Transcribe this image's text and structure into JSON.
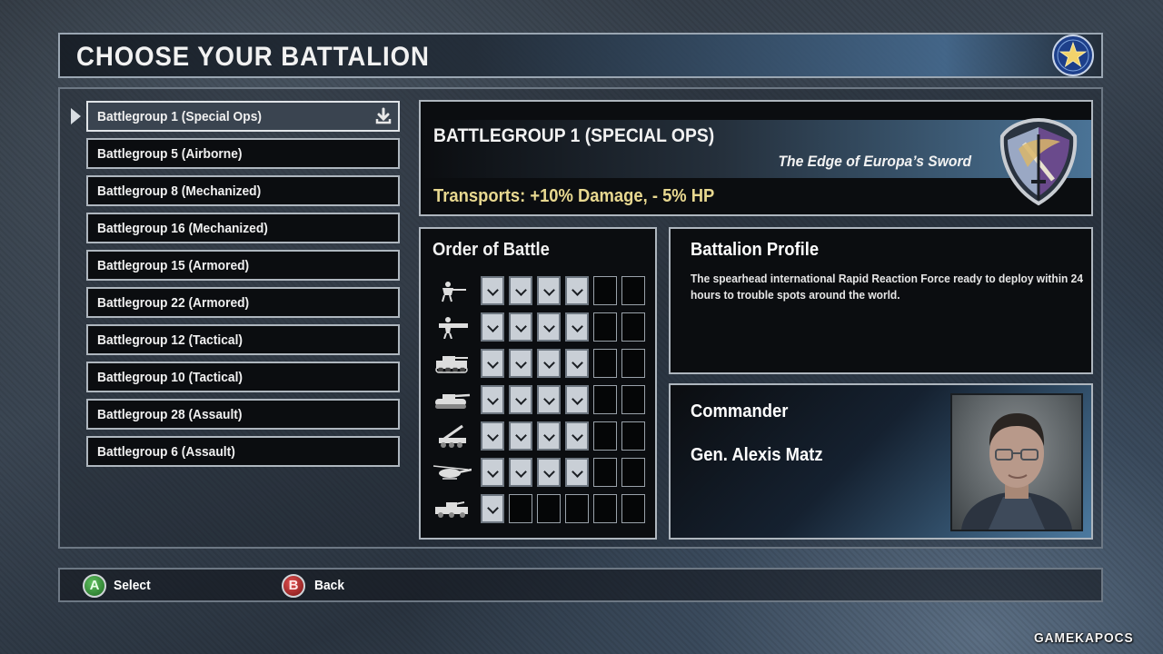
{
  "header": {
    "title": "CHOOSE YOUR BATTALION"
  },
  "battalions": [
    {
      "label": "Battlegroup 1 (Special Ops)",
      "selected": true
    },
    {
      "label": "Battlegroup 5 (Airborne)"
    },
    {
      "label": "Battlegroup 8 (Mechanized)"
    },
    {
      "label": "Battlegroup 16 (Mechanized)"
    },
    {
      "label": "Battlegroup 15 (Armored)"
    },
    {
      "label": "Battlegroup 22 (Armored)"
    },
    {
      "label": "Battlegroup 12 (Tactical)"
    },
    {
      "label": "Battlegroup 10 (Tactical)"
    },
    {
      "label": "Battlegroup 28 (Assault)"
    },
    {
      "label": "Battlegroup 6 (Assault)"
    }
  ],
  "detail": {
    "name": "BATTLEGROUP 1 (SPECIAL OPS)",
    "motto": "The Edge of Europa’s Sword",
    "bonus": "Transports: +10% Damage, - 5% HP"
  },
  "order_of_battle": {
    "title": "Order of Battle",
    "rows": [
      {
        "icon": "infantry-icon",
        "filled": 4,
        "total": 6
      },
      {
        "icon": "heavy-infantry-icon",
        "filled": 4,
        "total": 6
      },
      {
        "icon": "transport-vehicle-icon",
        "filled": 4,
        "total": 6
      },
      {
        "icon": "tank-icon",
        "filled": 4,
        "total": 6
      },
      {
        "icon": "artillery-icon",
        "filled": 4,
        "total": 6
      },
      {
        "icon": "helicopter-icon",
        "filled": 4,
        "total": 6
      },
      {
        "icon": "support-vehicle-icon",
        "filled": 1,
        "total": 6
      }
    ]
  },
  "profile": {
    "title": "Battalion Profile",
    "text": "The spearhead international Rapid Reaction Force ready to deploy within 24 hours to trouble spots around the world."
  },
  "commander": {
    "title": "Commander",
    "name": "Gen. Alexis Matz"
  },
  "footer": {
    "a_glyph": "A",
    "a_label": "Select",
    "b_glyph": "B",
    "b_label": "Back"
  },
  "watermark": "GAMEKAPOCS",
  "colors": {
    "bonus_text": "#e8d890",
    "accent_blue": "#4a7396",
    "button_a": "#1f6b23",
    "button_b": "#7a1414"
  }
}
